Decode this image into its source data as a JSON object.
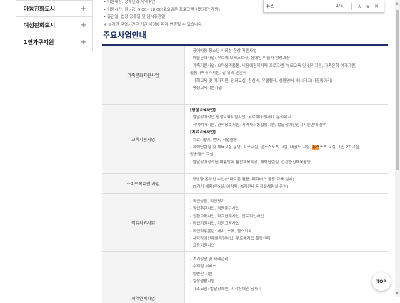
{
  "sidebar": {
    "items": [
      {
        "label": "아동친화도시"
      },
      {
        "label": "여성친화도시"
      },
      {
        "label": "1인가구지원"
      }
    ],
    "expand_symbol": "+"
  },
  "info_lines": [
    "• 이용대상: 장애인과 지역주민",
    "• 이용시간: 월~금, 9:00~18:00(토요일은 프로그램 이용자만 개방)",
    "• 휴관일: 법정 공휴일 및 임시휴관일",
    "※ 복지관 운영시간은 기관 사정에 따라 변경될 수 있습니다."
  ],
  "find": {
    "query": "뉴스",
    "count": "1/1",
    "up_symbol": "∧",
    "down_symbol": "∨",
    "close_symbol": "✕"
  },
  "section_title": "주요사업안내",
  "rows": [
    {
      "name": "가족문화지원사업",
      "lines": [
        {
          "text": "- 장애아동·청소년 사회성 향상 지원사업"
        },
        {
          "text": "- 예술문화사업: 무르예 오케스트라, 장애인 미술가 양성과정"
        },
        {
          "text": "- 가족지원사업: 오마음먹을통, 비장애형제자매 프로그램, 부모교육 및 심리지원, 가족문화 여가지원,"
        },
        {
          "text": "  돌봄가족휴가지원, 길 위의 인문학"
        },
        {
          "text": "- 사회교육 및 여가지원: 인화교실, 참심비, 우쿨렐레, 생활영어, 헤시태그(사진동아리)"
        },
        {
          "text": "- 평생교육지원사업"
        }
      ]
    },
    {
      "name": "교육지원사업",
      "lines": [
        {
          "text": "[평생교육사업]",
          "bold": true
        },
        {
          "text": "- 발달장애성인 평생교육지원사업: 무르예아카데미, 문화학교"
        },
        {
          "text": "- 취미여가지원, 관악옹호지원, 지역사회통합생지원, 발달장애인인지지원연대 참여"
        },
        {
          "text": "[치료교육사업]",
          "bold": true
        },
        {
          "text": "- 치료: 놀이, 언어, 작업활동"
        },
        {
          "text": "- 체력단련실 및 체육교실 운영: 탁구교실, 댄스스포츠 교실, 태권도 교실, ",
          "hl": "뉴스",
          "after": "포츠 교실, 1인 PT 교실,"
        },
        {
          "text": "  방송댄스 교실"
        },
        {
          "text": "- 발달장애청소년 여름방학 통합체육특강, 체력단련실, 건강증진체육활동"
        }
      ]
    },
    {
      "name": "스마트복지관 사업",
      "lines": [
        {
          "text": ". 쌍방향 온라인 수업(스마트폰 활용, 메타버스 활용 교육 실시)"
        },
        {
          "text": ". vr기기 체험(주5일, 예약제, 복지관내 디지털체험실 운영)"
        }
      ]
    },
    {
      "name": "직업지원사업",
      "lines": [
        {
          "text": "- 직업상담, 직업평가"
        },
        {
          "text": "- 직업훈련사업, 직종훈련사업"
        },
        {
          "text": "- 전환교육사업, 학교연계사업, 진로직업사업"
        },
        {
          "text": "- 취업지원사업, 지원고용사업"
        },
        {
          "text": "- 취업직무훈련: 세차, 소독, 헬스키퍼"
        },
        {
          "text": "- 사각장애인재활지원사업: 푸르메지업 힐링센터"
        },
        {
          "text": "- 고용지원사업"
        }
      ]
    },
    {
      "name": "지역연계사업",
      "lines": [
        {
          "text": "- 초기상담 및 사례관리"
        },
        {
          "text": "- 수지침 서비스"
        },
        {
          "text": "- 밑반찬 지원"
        },
        {
          "text": "- 일상생활지원"
        },
        {
          "text": "- 자조모임: 발달장애인, 시각장애인 당사자"
        }
      ]
    }
  ],
  "top_button": "TOP",
  "scroll": {
    "up": "▲",
    "down": "▼"
  }
}
